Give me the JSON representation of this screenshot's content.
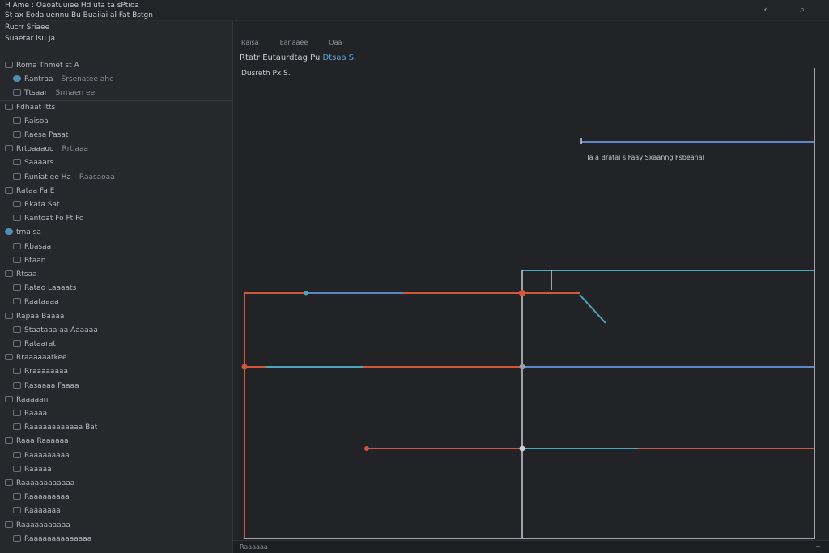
{
  "window": {
    "title_line1": "H Ame   :   Oaoatuuiee  Hd uta ta sPtioa",
    "title_line2": "St ax  Eodaiuennu  Bu  Buaiiai al  Fat Bstgn",
    "back_icon": "back-arrow-icon",
    "search_icon": "search-icon"
  },
  "sidebar": {
    "header": "Rucrr  Sriaee",
    "subheader": "Suaetar  lsu   Ja",
    "items": [
      {
        "label": "Roma  Thmet   st  A",
        "meta": "",
        "icon": "box"
      },
      {
        "label": "Rantraa",
        "meta": "Srsenatee ahe",
        "icon": "dot"
      },
      {
        "label": "Ttsaar",
        "meta": "Srmaen ee",
        "icon": "box"
      },
      {
        "label": "Fdhaat ltts",
        "meta": "",
        "icon": "box"
      },
      {
        "label": "Raisoa",
        "meta": "",
        "icon": "box"
      },
      {
        "label": "Raesa Pasat",
        "meta": "",
        "icon": "box"
      },
      {
        "label": "Rrtoaaaoo",
        "meta": "Rrtiaaa",
        "icon": "box"
      },
      {
        "label": "Saaaars",
        "meta": "",
        "icon": "box"
      },
      {
        "label": "Runiat ee  Ha",
        "meta": "Raasaoaa",
        "icon": "box"
      },
      {
        "label": "Rataa  Fa  E",
        "meta": "",
        "icon": "box"
      },
      {
        "label": "Rkata   Sat",
        "meta": "",
        "icon": "box"
      },
      {
        "label": "Rantoat  Fo  Ft  Fo",
        "meta": "",
        "icon": "box"
      },
      {
        "label": "tma sa",
        "meta": "",
        "icon": "dot"
      },
      {
        "label": "Rbasaa",
        "meta": "",
        "icon": "box"
      },
      {
        "label": "Btaan",
        "meta": "",
        "icon": "box"
      },
      {
        "label": "Rtsaa",
        "meta": "",
        "icon": "box"
      },
      {
        "label": "Ratao  Laaaats",
        "meta": "",
        "icon": "box"
      },
      {
        "label": "Raataaaa",
        "meta": "",
        "icon": "box"
      },
      {
        "label": "Rapaa Baaaa",
        "meta": "",
        "icon": "box"
      },
      {
        "label": "Staataaa  aa Aaaaaa",
        "meta": "",
        "icon": "box"
      },
      {
        "label": "Rataarat",
        "meta": "",
        "icon": "box"
      },
      {
        "label": "Rraaaaaatkee",
        "meta": "",
        "icon": "box"
      },
      {
        "label": "Rraaaaaaaa",
        "meta": "",
        "icon": "box"
      },
      {
        "label": "Rasaaaa Faaaa",
        "meta": "",
        "icon": "box"
      },
      {
        "label": "Raaaaan",
        "meta": "",
        "icon": "box"
      },
      {
        "label": "Raaaa",
        "meta": "",
        "icon": "box"
      },
      {
        "label": "Raaaaaaaaaaaa Bat",
        "meta": "",
        "icon": "box"
      },
      {
        "label": "Raaa Raaaaaa",
        "meta": "",
        "icon": "box"
      },
      {
        "label": "Raaaaaaaaa",
        "meta": "",
        "icon": "box"
      },
      {
        "label": "Raaaaa",
        "meta": "",
        "icon": "box"
      },
      {
        "label": "Raaaaaaaaaaaa",
        "meta": "",
        "icon": "box"
      },
      {
        "label": "Raaaaaaaaa",
        "meta": "",
        "icon": "box"
      },
      {
        "label": "Raaaaaaa",
        "meta": "",
        "icon": "box"
      },
      {
        "label": "Raaaaaaaaaaa",
        "meta": "",
        "icon": "box"
      },
      {
        "label": "Raaaaaaaaaaaaaa",
        "meta": "",
        "icon": "box"
      }
    ]
  },
  "main": {
    "tabs": [
      "Raisa",
      "Eanaaee",
      "Oaa"
    ],
    "title_prefix": "Rtatr  Eutaurdtag  Pu",
    "title_accent": "Dtsaa  S.",
    "diagram_label": "Dusreth  Px  S.",
    "annotation": "Ta   a    Bratal  s Faay  Sxaanng  Fsbeanal",
    "status_left": "Raaaaaa",
    "status_right": "+"
  },
  "colors": {
    "line_blue": "#5f86c9",
    "line_orange": "#d0583a",
    "line_teal": "#4aa6b8",
    "node_fill": "#d0583a"
  }
}
